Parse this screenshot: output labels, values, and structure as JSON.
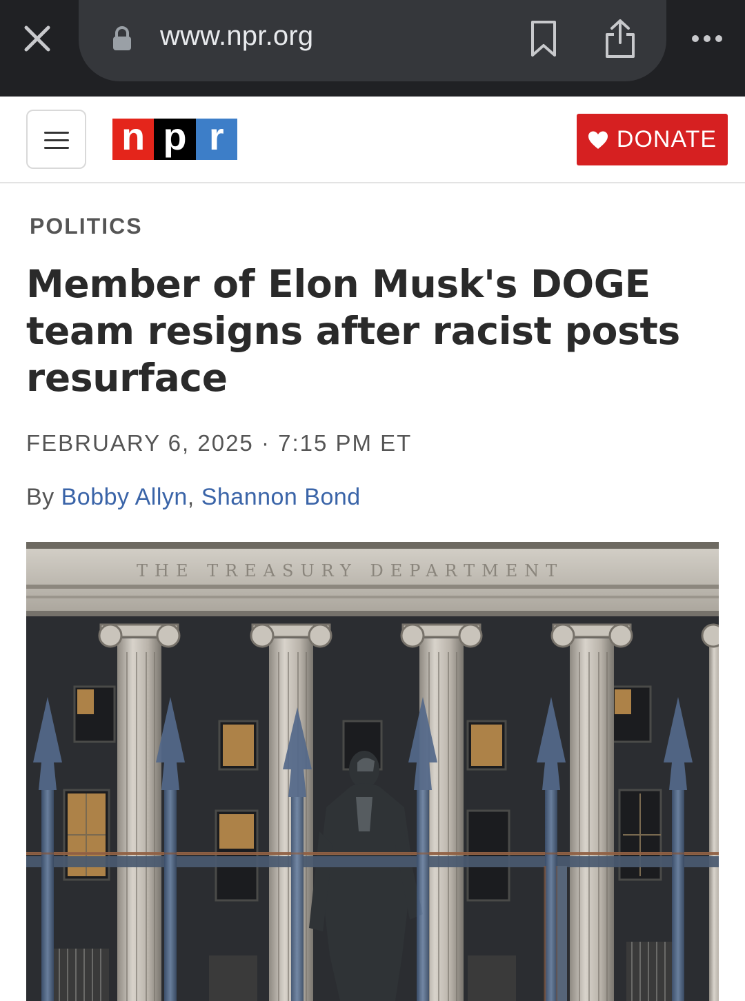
{
  "browser": {
    "url": "www.npr.org",
    "icons": [
      "close-icon",
      "lock-icon",
      "bookmark-icon",
      "share-icon",
      "more-icon"
    ]
  },
  "header": {
    "logo_letters": [
      "n",
      "p",
      "r"
    ],
    "donate_label": "DONATE",
    "colors": {
      "npr_red": "#e4251b",
      "npr_black": "#000000",
      "npr_blue": "#3d7ec8",
      "donate_red": "#d62021"
    }
  },
  "article": {
    "section": "POLITICS",
    "headline": "Member of Elon Musk's DOGE team resigns after racist posts resurface",
    "dateline": "FEBRUARY 6, 2025 · 7:15 PM ET",
    "by_prefix": "By ",
    "authors": [
      "Bobby Allyn",
      "Shannon Bond"
    ],
    "author_separator": ", ",
    "image": {
      "inscription": "THE  TREASURY  DEPARTMENT"
    }
  }
}
